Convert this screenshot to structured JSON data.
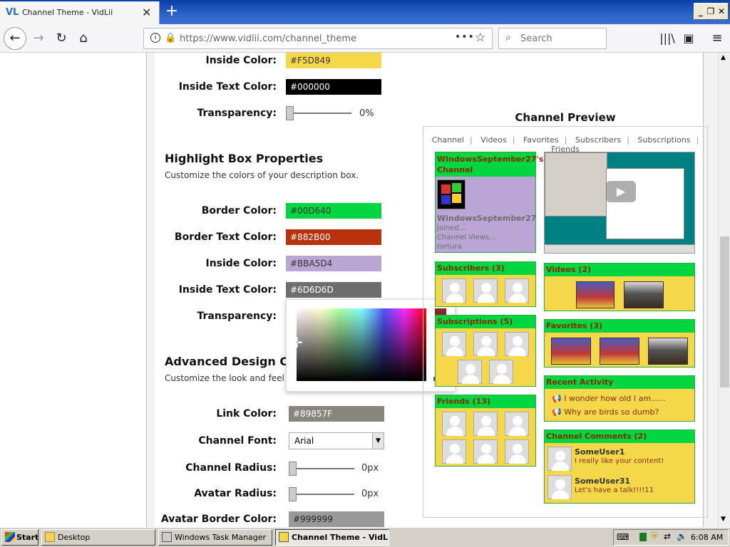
{
  "browser": {
    "tab_title": "Channel Theme - VidLii",
    "url": "https://www.vidlii.com/channel_theme",
    "search_placeholder": "Search",
    "new_tab_symbol": "+",
    "close_symbol": "✕"
  },
  "form": {
    "inside_color_label": "Inside Color:",
    "inside_color_value": "#F5D849",
    "inside_text_color_label": "Inside Text Color:",
    "inside_text_color_value": "#000000",
    "transparency_label": "Transparency:",
    "transparency_value": "0%",
    "highlight": {
      "title": "Highlight Box Properties",
      "desc": "Customize the colors of your description box.",
      "border_color_label": "Border Color:",
      "border_color_value": "#00D640",
      "border_text_color_label": "Border Text Color:",
      "border_text_color_value": "#882B00",
      "inside_color_label": "Inside Color:",
      "inside_color_value": "#BBA5D4",
      "inside_text_color_label": "Inside Text Color:",
      "inside_text_color_value": "#6D6D6D",
      "transparency_label": "Transparency:"
    },
    "advanced": {
      "title": "Advanced Design Opti",
      "desc": "Customize the look and feel o",
      "link_color_label": "Link Color:",
      "link_color_value": "#89857F",
      "channel_font_label": "Channel Font:",
      "channel_font_value": "Arial",
      "channel_radius_label": "Channel Radius:",
      "channel_radius_value": "0px",
      "avatar_radius_label": "Avatar Radius:",
      "avatar_radius_value": "0px",
      "avatar_border_color_label": "Avatar Border Color:",
      "avatar_border_color_value": "#999999"
    }
  },
  "preview": {
    "title": "Channel Preview",
    "nav": [
      "Channel",
      "Videos",
      "Favorites",
      "Subscribers",
      "Subscriptions",
      "Friends"
    ],
    "channel_box": {
      "header": "WindowsSeptember27's Channel",
      "username": "WindowsSeptember27",
      "joined": "Joined...",
      "views": "Channel Views...",
      "extra": "tortura"
    },
    "subscribers": "Subscribers (3)",
    "subscriptions": "Subscriptions (5)",
    "friends": "Friends (13)",
    "videos": "Videos (2)",
    "favorites": "Favorites (3)",
    "recent_activity": {
      "header": "Recent Activity",
      "items": [
        "I wonder how old I am......",
        "Why are birds so dumb?"
      ]
    },
    "comments": {
      "header": "Channel Comments (2)",
      "items": [
        {
          "user": "SomeUser1",
          "text": "I really like your content!"
        },
        {
          "user": "SomeUser31",
          "text": "Let's have a talk!!!!11"
        }
      ]
    }
  },
  "taskbar": {
    "start": "Start",
    "items": [
      "Desktop",
      "Windows Task Manager",
      "Channel Theme - VidLi..."
    ],
    "clock": "6:08 AM"
  },
  "colors": {
    "inside": "#F5D849",
    "border": "#00D640",
    "border_text": "#882B00",
    "inside_highlight": "#BBA5D4",
    "inside_text": "#6D6D6D",
    "link": "#89857F",
    "avatar_border": "#999999"
  }
}
